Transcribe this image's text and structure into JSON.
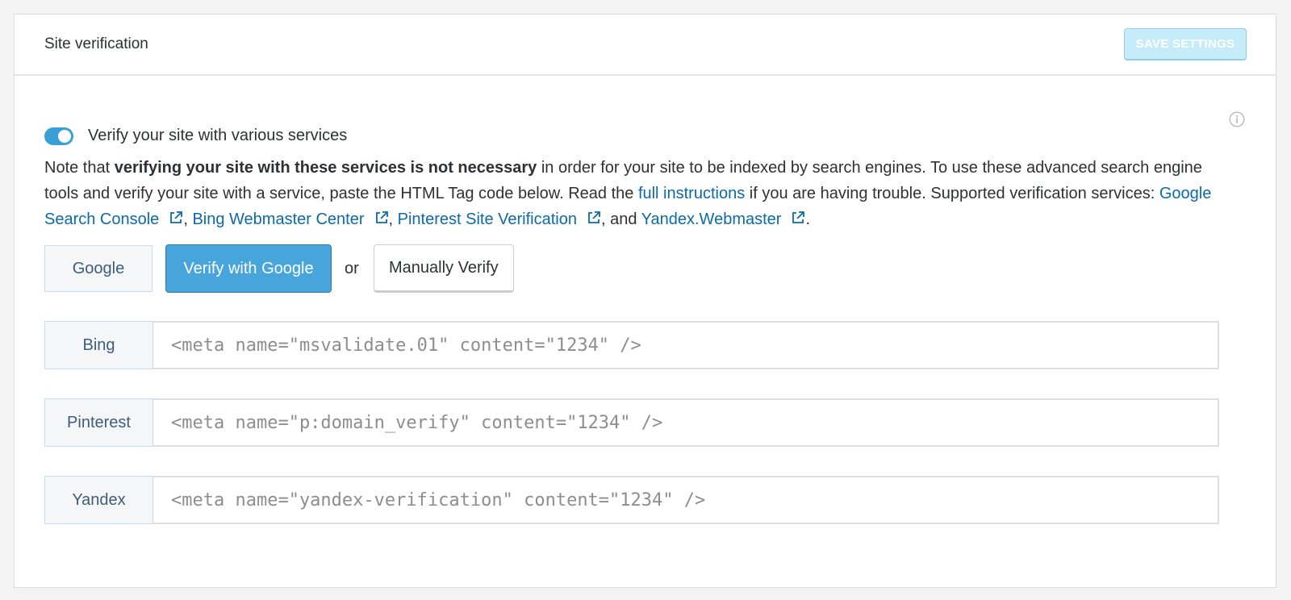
{
  "header": {
    "title": "Site verification",
    "save_label": "SAVE SETTINGS"
  },
  "toggle": {
    "label": "Verify your site with various services",
    "enabled": true
  },
  "note": {
    "intro": "Note that ",
    "bold": "verifying your site with these services is not necessary",
    "middle": " in order for your site to be indexed by search engines. To use these advanced search engine tools and verify your site with a service, paste the HTML Tag code below. Read the ",
    "instructions_link": "full instructions",
    "after_link": " if you are having trouble. Supported verification services: ",
    "services": [
      {
        "label": "Google Search Console"
      },
      {
        "label": "Bing Webmaster Center"
      },
      {
        "label": "Pinterest Site Verification"
      },
      {
        "label": "Yandex.Webmaster"
      }
    ],
    "sep1": ", ",
    "sep2": ", ",
    "sep3": ", and ",
    "end": "."
  },
  "google": {
    "label": "Google",
    "verify_button": "Verify with Google",
    "or": "or",
    "manual_button": "Manually Verify"
  },
  "fields": [
    {
      "label": "Bing",
      "value": "",
      "placeholder": "<meta name=\"msvalidate.01\" content=\"1234\" />"
    },
    {
      "label": "Pinterest",
      "value": "",
      "placeholder": "<meta name=\"p:domain_verify\" content=\"1234\" />"
    },
    {
      "label": "Yandex",
      "value": "",
      "placeholder": "<meta name=\"yandex-verification\" content=\"1234\" />"
    }
  ],
  "colors": {
    "accent": "#47a5dc",
    "link": "#0c6aa8",
    "toggle_on": "#3a9fd6"
  }
}
